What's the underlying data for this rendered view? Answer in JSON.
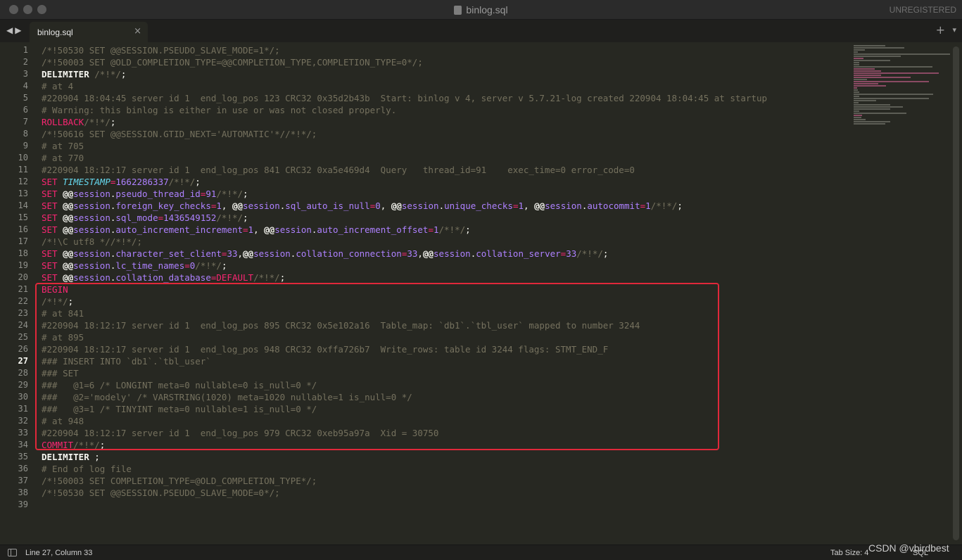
{
  "window": {
    "title": "binlog.sql",
    "unregistered": "UNREGISTERED"
  },
  "tabs": [
    {
      "label": "binlog.sql",
      "close": "×"
    }
  ],
  "tabbar": {
    "back": "◀",
    "forward": "▶",
    "new_tab": "+",
    "more": "▾"
  },
  "editor": {
    "active_line": 27,
    "line_numbers": [
      "1",
      "2",
      "3",
      "4",
      "5",
      "6",
      "7",
      "8",
      "9",
      "10",
      "11",
      "12",
      "13",
      "14",
      "15",
      "16",
      "17",
      "18",
      "19",
      "20",
      "21",
      "22",
      "23",
      "24",
      "25",
      "26",
      "27",
      "28",
      "29",
      "30",
      "31",
      "32",
      "33",
      "34",
      "35",
      "36",
      "37",
      "38",
      "39"
    ],
    "lines": [
      [
        [
          "c",
          "/*!50530 SET @@SESSION.PSEUDO_SLAVE_MODE=1*/;"
        ]
      ],
      [
        [
          "c",
          "/*!50003 SET @OLD_COMPLETION_TYPE=@@COMPLETION_TYPE,COMPLETION_TYPE=0*/;"
        ]
      ],
      [
        [
          "b",
          "DELIMITER "
        ],
        [
          "c",
          "/*!*/"
        ],
        [
          "w",
          ";"
        ]
      ],
      [
        [
          "c",
          "# at 4"
        ]
      ],
      [
        [
          "c",
          "#220904 18:04:45 server id 1  end_log_pos 123 CRC32 0x35d2b43b  Start: binlog v 4, server v 5.7.21-log created 220904 18:04:45 at startup"
        ]
      ],
      [
        [
          "c",
          "# Warning: this binlog is either in use or was not closed properly."
        ]
      ],
      [
        [
          "k",
          "ROLLBACK"
        ],
        [
          "c",
          "/*!*/"
        ],
        [
          "w",
          ";"
        ]
      ],
      [
        [
          "c",
          "/*!50616 SET @@SESSION.GTID_NEXT='AUTOMATIC'*//*!*/;"
        ]
      ],
      [
        [
          "c",
          "# at 705"
        ]
      ],
      [
        [
          "c",
          "# at 770"
        ]
      ],
      [
        [
          "c",
          "#220904 18:12:17 server id 1  end_log_pos 841 CRC32 0xa5e469d4  Query   thread_id=91    exec_time=0 error_code=0"
        ]
      ],
      [
        [
          "k",
          "SET "
        ],
        [
          "f",
          "TIMESTAMP"
        ],
        [
          "k",
          "="
        ],
        [
          "v",
          "1662286337"
        ],
        [
          "c",
          "/*!*/"
        ],
        [
          "w",
          ";"
        ]
      ],
      [
        [
          "k",
          "SET "
        ],
        [
          "b",
          "@@"
        ],
        [
          "v",
          "session"
        ],
        [
          "w",
          "."
        ],
        [
          "v",
          "pseudo_thread_id"
        ],
        [
          "k",
          "="
        ],
        [
          "v",
          "91"
        ],
        [
          "c",
          "/*!*/"
        ],
        [
          "w",
          ";"
        ]
      ],
      [
        [
          "k",
          "SET "
        ],
        [
          "b",
          "@@"
        ],
        [
          "v",
          "session"
        ],
        [
          "w",
          "."
        ],
        [
          "v",
          "foreign_key_checks"
        ],
        [
          "k",
          "="
        ],
        [
          "v",
          "1"
        ],
        [
          "w",
          ", "
        ],
        [
          "b",
          "@@"
        ],
        [
          "v",
          "session"
        ],
        [
          "w",
          "."
        ],
        [
          "v",
          "sql_auto_is_null"
        ],
        [
          "k",
          "="
        ],
        [
          "v",
          "0"
        ],
        [
          "w",
          ", "
        ],
        [
          "b",
          "@@"
        ],
        [
          "v",
          "session"
        ],
        [
          "w",
          "."
        ],
        [
          "v",
          "unique_checks"
        ],
        [
          "k",
          "="
        ],
        [
          "v",
          "1"
        ],
        [
          "w",
          ", "
        ],
        [
          "b",
          "@@"
        ],
        [
          "v",
          "session"
        ],
        [
          "w",
          "."
        ],
        [
          "v",
          "autocommit"
        ],
        [
          "k",
          "="
        ],
        [
          "v",
          "1"
        ],
        [
          "c",
          "/*!*/"
        ],
        [
          "w",
          ";"
        ]
      ],
      [
        [
          "k",
          "SET "
        ],
        [
          "b",
          "@@"
        ],
        [
          "v",
          "session"
        ],
        [
          "w",
          "."
        ],
        [
          "v",
          "sql_mode"
        ],
        [
          "k",
          "="
        ],
        [
          "v",
          "1436549152"
        ],
        [
          "c",
          "/*!*/"
        ],
        [
          "w",
          ";"
        ]
      ],
      [
        [
          "k",
          "SET "
        ],
        [
          "b",
          "@@"
        ],
        [
          "v",
          "session"
        ],
        [
          "w",
          "."
        ],
        [
          "v",
          "auto_increment_increment"
        ],
        [
          "k",
          "="
        ],
        [
          "v",
          "1"
        ],
        [
          "w",
          ", "
        ],
        [
          "b",
          "@@"
        ],
        [
          "v",
          "session"
        ],
        [
          "w",
          "."
        ],
        [
          "v",
          "auto_increment_offset"
        ],
        [
          "k",
          "="
        ],
        [
          "v",
          "1"
        ],
        [
          "c",
          "/*!*/"
        ],
        [
          "w",
          ";"
        ]
      ],
      [
        [
          "c",
          "/*!\\C utf8 *//*!*/;"
        ]
      ],
      [
        [
          "k",
          "SET "
        ],
        [
          "b",
          "@@"
        ],
        [
          "v",
          "session"
        ],
        [
          "w",
          "."
        ],
        [
          "v",
          "character_set_client"
        ],
        [
          "k",
          "="
        ],
        [
          "v",
          "33"
        ],
        [
          "w",
          ","
        ],
        [
          "b",
          "@@"
        ],
        [
          "v",
          "session"
        ],
        [
          "w",
          "."
        ],
        [
          "v",
          "collation_connection"
        ],
        [
          "k",
          "="
        ],
        [
          "v",
          "33"
        ],
        [
          "w",
          ","
        ],
        [
          "b",
          "@@"
        ],
        [
          "v",
          "session"
        ],
        [
          "w",
          "."
        ],
        [
          "v",
          "collation_server"
        ],
        [
          "k",
          "="
        ],
        [
          "v",
          "33"
        ],
        [
          "c",
          "/*!*/"
        ],
        [
          "w",
          ";"
        ]
      ],
      [
        [
          "k",
          "SET "
        ],
        [
          "b",
          "@@"
        ],
        [
          "v",
          "session"
        ],
        [
          "w",
          "."
        ],
        [
          "v",
          "lc_time_names"
        ],
        [
          "k",
          "="
        ],
        [
          "v",
          "0"
        ],
        [
          "c",
          "/*!*/"
        ],
        [
          "w",
          ";"
        ]
      ],
      [
        [
          "k",
          "SET "
        ],
        [
          "b",
          "@@"
        ],
        [
          "v",
          "session"
        ],
        [
          "w",
          "."
        ],
        [
          "v",
          "collation_database"
        ],
        [
          "k",
          "=DEFAULT"
        ],
        [
          "c",
          "/*!*/"
        ],
        [
          "w",
          ";"
        ]
      ],
      [
        [
          "k",
          "BEGIN"
        ]
      ],
      [
        [
          "c",
          "/*!*/"
        ],
        [
          "w",
          ";"
        ]
      ],
      [
        [
          "c",
          "# at 841"
        ]
      ],
      [
        [
          "c",
          "#220904 18:12:17 server id 1  end_log_pos 895 CRC32 0x5e102a16  Table_map: `db1`.`tbl_user` mapped to number 3244"
        ]
      ],
      [
        [
          "c",
          "# at 895"
        ]
      ],
      [
        [
          "c",
          "#220904 18:12:17 server id 1  end_log_pos 948 CRC32 0xffa726b7  Write_rows: table id 3244 flags: STMT_END_F"
        ]
      ],
      [
        [
          "c",
          "### INSERT INTO `db1`.`tbl_user`"
        ]
      ],
      [
        [
          "c",
          "### SET"
        ]
      ],
      [
        [
          "c",
          "###   @1=6 /* LONGINT meta=0 nullable=0 is_null=0 */"
        ]
      ],
      [
        [
          "c",
          "###   @2='modely' /* VARSTRING(1020) meta=1020 nullable=1 is_null=0 */"
        ]
      ],
      [
        [
          "c",
          "###   @3=1 /* TINYINT meta=0 nullable=1 is_null=0 */"
        ]
      ],
      [
        [
          "c",
          "# at 948"
        ]
      ],
      [
        [
          "c",
          "#220904 18:12:17 server id 1  end_log_pos 979 CRC32 0xeb95a97a  Xid = 30750"
        ]
      ],
      [
        [
          "k",
          "COMMIT"
        ],
        [
          "c",
          "/*!*/"
        ],
        [
          "w",
          ";"
        ]
      ],
      [
        [
          "b",
          "DELIMITER "
        ],
        [
          "w",
          ";"
        ]
      ],
      [
        [
          "c",
          "# End of log file"
        ]
      ],
      [
        [
          "c",
          "/*!50003 SET COMPLETION_TYPE=@OLD_COMPLETION_TYPE*/;"
        ]
      ],
      [
        [
          "c",
          "/*!50530 SET @@SESSION.PSEUDO_SLAVE_MODE=0*/;"
        ]
      ],
      []
    ]
  },
  "status": {
    "position": "Line 27, Column 33",
    "tab_size": "Tab Size: 4",
    "syntax": "SQL"
  },
  "watermark": "CSDN @vbirdbest",
  "colors": {
    "background": "#272822",
    "comment": "#75715e",
    "keyword": "#f92672",
    "constant": "#ae81ff",
    "function": "#66d9ef",
    "highlight_box": "#e0283a"
  }
}
